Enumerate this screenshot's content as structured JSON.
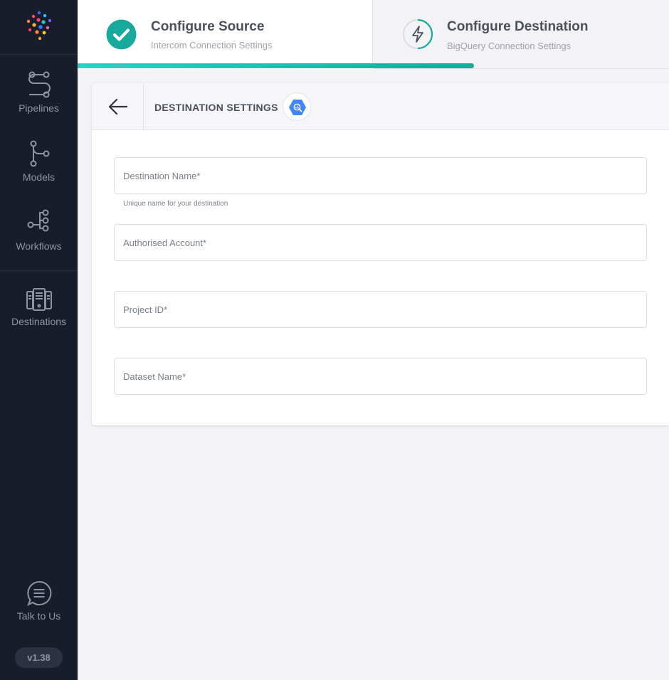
{
  "sidebar": {
    "items": [
      {
        "label": "Pipelines",
        "icon": "pipelines-icon"
      },
      {
        "label": "Models",
        "icon": "models-icon"
      },
      {
        "label": "Workflows",
        "icon": "workflows-icon"
      },
      {
        "label": "Destinations",
        "icon": "destinations-icon"
      }
    ],
    "talk": {
      "label": "Talk to Us",
      "icon": "chat-icon"
    },
    "version": "v1.38"
  },
  "stepper": {
    "steps": [
      {
        "title": "Configure Source",
        "subtitle": "Intercom Connection Settings",
        "status": "complete",
        "icon": "check-icon"
      },
      {
        "title": "Configure Destination",
        "subtitle": "BigQuery Connection Settings",
        "status": "active",
        "icon": "lightning-icon"
      }
    ],
    "progress_percent": 67
  },
  "card": {
    "title": "DESTINATION SETTINGS",
    "logo_icon": "bigquery-icon",
    "fields": [
      {
        "placeholder": "Destination Name*",
        "value": "",
        "hint": "Unique name for your destination"
      },
      {
        "placeholder": "Authorised Account*",
        "value": ""
      },
      {
        "placeholder": "Project ID*",
        "value": ""
      },
      {
        "placeholder": "Dataset Name*",
        "value": ""
      }
    ]
  },
  "colors": {
    "sidebar_bg": "#181d2c",
    "accent_teal": "#16a99c",
    "bigquery_blue": "#4285f4"
  }
}
